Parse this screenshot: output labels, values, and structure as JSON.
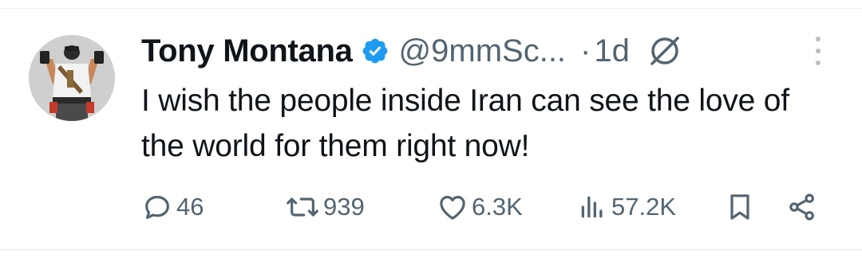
{
  "tweet": {
    "author_name": "Tony Montana",
    "handle": "@9mmSc...",
    "separator": "·",
    "time": "1d",
    "text": "I wish the people inside Iran can see the love of the world for them right now!",
    "verified": true
  },
  "actions": {
    "replies": "46",
    "retweets": "939",
    "likes": "6.3K",
    "views": "57.2K"
  },
  "icons": {
    "verified": "verified-badge-icon",
    "grok": "grok-icon",
    "more": "more-vertical-icon",
    "reply": "reply-icon",
    "retweet": "retweet-icon",
    "like": "heart-icon",
    "views": "views-icon",
    "bookmark": "bookmark-icon",
    "share": "share-icon"
  },
  "colors": {
    "text": "#0f1419",
    "muted": "#536471",
    "verified": "#1d9bf0"
  }
}
